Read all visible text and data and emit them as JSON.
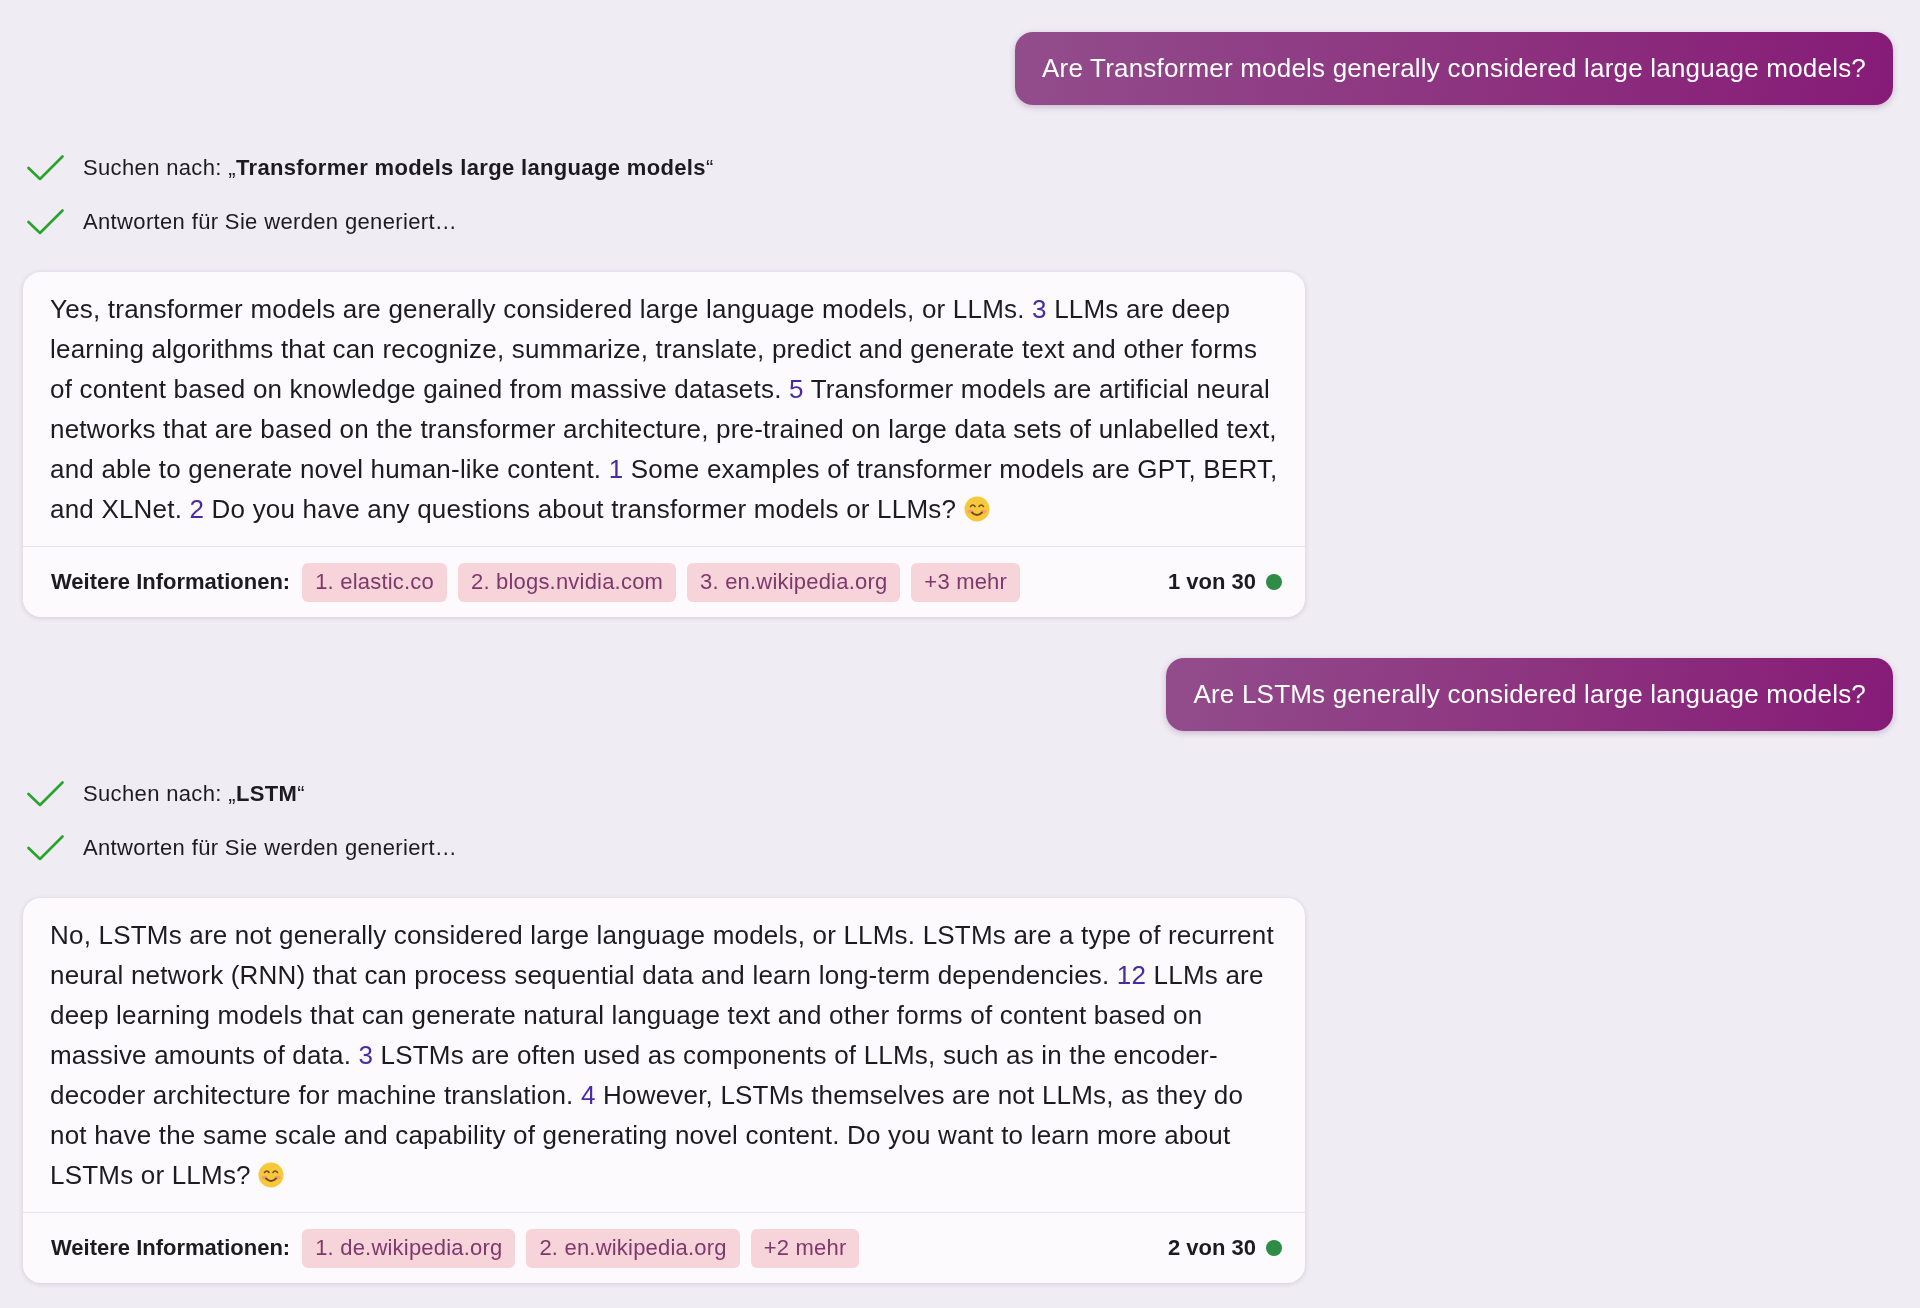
{
  "messages": [
    {
      "kind": "user",
      "text": "Are Transformer models generally considered large language models?"
    },
    {
      "kind": "progress",
      "steps": [
        {
          "text": "Suchen nach: „**Transformer models large language models**“",
          "done": true
        },
        {
          "text": "Antworten für Sie werden generiert…",
          "done": true
        }
      ]
    },
    {
      "kind": "answer",
      "segments": [
        {
          "kind": "text",
          "text": "Yes, transformer models are generally considered large language models, or LLMs. "
        },
        {
          "kind": "citation",
          "text": "3"
        },
        {
          "kind": "text",
          "text": " LLMs are deep learning algorithms that can recognize, summarize, translate, predict and generate text and other forms of content based on knowledge gained from massive datasets. "
        },
        {
          "kind": "citation",
          "text": "5"
        },
        {
          "kind": "text",
          "text": " Transformer models are artificial neural networks that are based on the transformer architecture, pre-trained on large data sets of unlabelled text, and able to generate novel human-like content. "
        },
        {
          "kind": "citation",
          "text": "1"
        },
        {
          "kind": "text",
          "text": " Some examples of transformer models are GPT, BERT, and XLNet. "
        },
        {
          "kind": "citation",
          "text": "2"
        },
        {
          "kind": "text",
          "text": " Do you have any questions about transformer models or LLMs? "
        },
        {
          "kind": "emoji"
        }
      ],
      "sources_label": "Weitere Informationen:",
      "sources": [
        "1. elastic.co",
        "2. blogs.nvidia.com",
        "3. en.wikipedia.org"
      ],
      "more": "+3 mehr",
      "counter": "1 von 30"
    },
    {
      "kind": "user",
      "text": "Are LSTMs generally considered large language models?"
    },
    {
      "kind": "progress",
      "steps": [
        {
          "text": "Suchen nach: „**LSTM**“",
          "done": true
        },
        {
          "text": "Antworten für Sie werden generiert…",
          "done": true
        }
      ]
    },
    {
      "kind": "answer",
      "segments": [
        {
          "kind": "text",
          "text": "No, LSTMs are not generally considered large language models, or LLMs. LSTMs are a type of recurrent neural network (RNN) that can process sequential data and learn long-term dependencies. "
        },
        {
          "kind": "citation",
          "text": "12"
        },
        {
          "kind": "text",
          "text": " LLMs are deep learning models that can generate natural language text and other forms of content based on massive amounts of data. "
        },
        {
          "kind": "citation",
          "text": "3"
        },
        {
          "kind": "text",
          "text": " LSTMs are often used as components of LLMs, such as in the encoder-decoder architecture for machine translation. "
        },
        {
          "kind": "citation",
          "text": "4"
        },
        {
          "kind": "text",
          "text": " However, LSTMs themselves are not LLMs, as they do not have the same scale and capability of generating novel content. Do you want to learn more about LSTMs or LLMs? "
        },
        {
          "kind": "emoji"
        }
      ],
      "sources_label": "Weitere Informationen:",
      "sources": [
        "1. de.wikipedia.org",
        "2. en.wikipedia.org"
      ],
      "more": "+2 mehr",
      "counter": "2 von 30"
    }
  ]
}
